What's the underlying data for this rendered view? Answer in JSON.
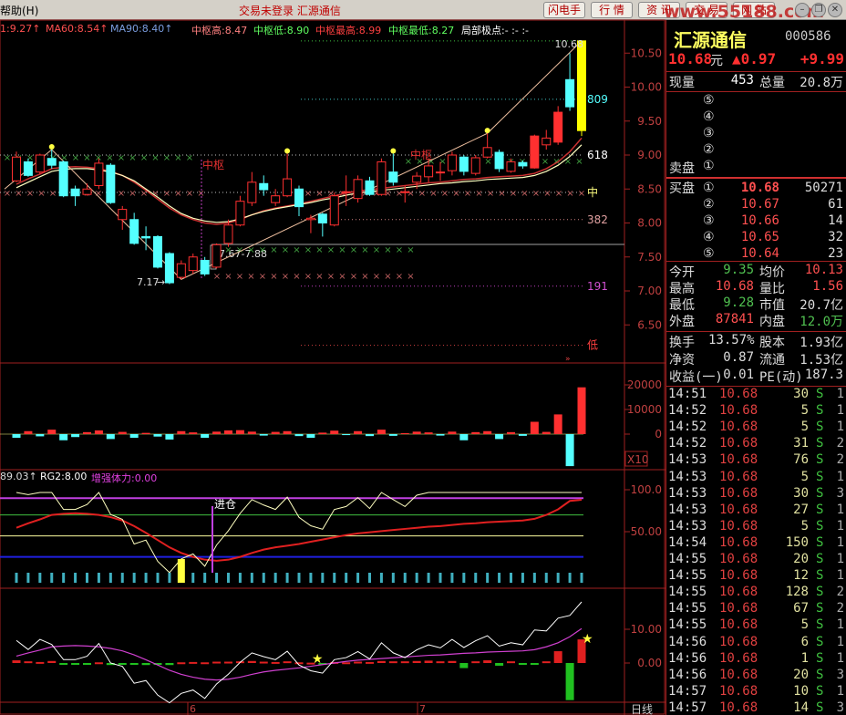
{
  "menu": {
    "help": "帮助(H)"
  },
  "window_title": "交易未登录  汇源通信",
  "toolbar": {
    "buttons": [
      "闪电手",
      "行 情",
      "资 讯",
      "交 易",
      "网 站"
    ],
    "watermark": "www.55188.com",
    "controls": [
      "–",
      "❐",
      "✕"
    ]
  },
  "indicators": {
    "ma_partial": "1:9.27↑",
    "ma60": "MA60:8.54↑",
    "ma90": "MA90:8.40↑",
    "zs_high": "中枢高:8.47",
    "zs_low": "中枢低:8.90",
    "zs_max": "中枢最高:8.99",
    "zs_min": "中枢最低:8.27",
    "local_extreme": "局部极点:- :- :-"
  },
  "annotations": {
    "high_price": "10.68",
    "low_price": "7.17",
    "range": "7.67-7.88",
    "zhongshu1": "中枢",
    "zhongshu2": "中枢",
    "fib809": "809",
    "fib618": "618",
    "mid": "中",
    "fib382": "382",
    "fib191": "191",
    "low": "低",
    "jincang": "进仓"
  },
  "price_axis": [
    "10.50",
    "10.00",
    "9.50",
    "9.00",
    "8.50",
    "8.00",
    "7.50",
    "7.00",
    "6.50"
  ],
  "volume_axis": [
    "20000",
    "10000",
    "0"
  ],
  "volume_unit": "X10",
  "rsi_header": {
    "v1": "89.03↑",
    "rg2": "RG2:8.00",
    "strength": "增强体力:0.00"
  },
  "rsi_axis": [
    "100.0",
    "50.00"
  ],
  "macd_axis": [
    "10.00",
    "0.00"
  ],
  "date_axis": {
    "m6": "6",
    "m7": "7",
    "period": "日线"
  },
  "colors": {
    "up": "#ff3030",
    "down": "#54ffff",
    "limit": "#ffff00",
    "ma60": "#c83030",
    "ma90": "#ffffc0",
    "accent": "#a02020"
  },
  "chart_data": {
    "type": "candlestick",
    "candles": [
      [
        8.62,
        8.97,
        9.05,
        8.6
      ],
      [
        8.9,
        8.7,
        8.95,
        8.68
      ],
      [
        8.75,
        9.0,
        9.02,
        8.72
      ],
      [
        8.95,
        8.85,
        9.08,
        8.8
      ],
      [
        8.9,
        8.4,
        8.92,
        8.38
      ],
      [
        8.5,
        8.4,
        8.55,
        8.25
      ],
      [
        8.42,
        8.5,
        8.58,
        8.4
      ],
      [
        8.55,
        8.88,
        8.95,
        8.5
      ],
      [
        8.85,
        8.3,
        8.88,
        8.28
      ],
      [
        8.05,
        8.2,
        8.25,
        7.9
      ],
      [
        8.05,
        7.7,
        8.15,
        7.68
      ],
      [
        7.8,
        7.78,
        7.95,
        7.6
      ],
      [
        7.8,
        7.35,
        7.82,
        7.33
      ],
      [
        7.55,
        7.12,
        7.57,
        7.1
      ],
      [
        7.2,
        7.4,
        7.45,
        7.17
      ],
      [
        7.3,
        7.5,
        7.55,
        7.25
      ],
      [
        7.45,
        7.25,
        7.5,
        7.22
      ],
      [
        7.35,
        7.68,
        7.7,
        7.33
      ],
      [
        7.7,
        7.97,
        8.05,
        7.65
      ],
      [
        7.97,
        8.32,
        8.4,
        7.95
      ],
      [
        8.3,
        8.6,
        8.75,
        8.25
      ],
      [
        8.58,
        8.49,
        8.7,
        8.4
      ],
      [
        8.3,
        8.4,
        8.5,
        8.25
      ],
      [
        8.4,
        8.65,
        9.02,
        8.38
      ],
      [
        8.5,
        8.24,
        8.55,
        8.1
      ],
      [
        8.05,
        8.07,
        8.12,
        7.85
      ],
      [
        8.13,
        8.0,
        8.15,
        7.8
      ],
      [
        7.97,
        8.4,
        8.45,
        7.95
      ],
      [
        8.45,
        8.46,
        8.7,
        8.25
      ],
      [
        8.36,
        8.64,
        8.7,
        8.3
      ],
      [
        8.62,
        8.42,
        8.68,
        8.4
      ],
      [
        8.42,
        8.9,
        8.95,
        8.4
      ],
      [
        8.75,
        8.6,
        9.02,
        8.55
      ],
      [
        8.45,
        8.46,
        8.55,
        8.3
      ],
      [
        8.6,
        8.69,
        8.75,
        8.5
      ],
      [
        8.68,
        8.84,
        8.95,
        8.6
      ],
      [
        8.75,
        8.75,
        8.9,
        8.62
      ],
      [
        8.77,
        9.0,
        9.05,
        8.7
      ],
      [
        8.97,
        8.76,
        9.0,
        8.7
      ],
      [
        8.73,
        8.96,
        9.0,
        8.7
      ],
      [
        8.97,
        9.11,
        9.32,
        8.95
      ],
      [
        9.04,
        8.8,
        9.08,
        8.75
      ],
      [
        8.76,
        8.9,
        8.95,
        8.74
      ],
      [
        8.89,
        8.84,
        8.92,
        8.8
      ],
      [
        8.81,
        9.28,
        9.3,
        8.8
      ],
      [
        9.15,
        9.25,
        9.37,
        9.08
      ],
      [
        9.19,
        9.63,
        9.72,
        9.15
      ],
      [
        10.11,
        9.71,
        10.5,
        9.65
      ],
      [
        9.36,
        10.68,
        10.68,
        9.28
      ]
    ],
    "solid_up": [
      44,
      46
    ],
    "limit_up": [
      48
    ],
    "ma60": [
      8.57,
      8.65,
      8.72,
      8.8,
      8.82,
      8.83,
      8.82,
      8.8,
      8.76,
      8.7,
      8.6,
      8.48,
      8.35,
      8.22,
      8.12,
      8.05,
      8.0,
      7.98,
      8.0,
      8.05,
      8.12,
      8.18,
      8.22,
      8.25,
      8.28,
      8.32,
      8.36,
      8.4,
      8.44,
      8.47,
      8.49,
      8.51,
      8.53,
      8.55,
      8.57,
      8.59,
      8.6,
      8.62,
      8.64,
      8.65,
      8.67,
      8.68,
      8.69,
      8.7,
      8.73,
      8.8,
      8.9,
      9.05,
      9.25
    ],
    "ma90": [
      8.52,
      8.6,
      8.68,
      8.76,
      8.79,
      8.8,
      8.8,
      8.78,
      8.75,
      8.7,
      8.62,
      8.5,
      8.38,
      8.25,
      8.14,
      8.07,
      8.03,
      8.01,
      8.02,
      8.06,
      8.12,
      8.17,
      8.21,
      8.24,
      8.27,
      8.3,
      8.34,
      8.37,
      8.41,
      8.44,
      8.46,
      8.48,
      8.5,
      8.52,
      8.54,
      8.56,
      8.58,
      8.59,
      8.61,
      8.62,
      8.64,
      8.65,
      8.66,
      8.67,
      8.7,
      8.76,
      8.85,
      8.98,
      9.15
    ],
    "zigzag": [
      [
        0,
        8.5
      ],
      [
        3,
        9.08
      ],
      [
        14,
        7.17
      ],
      [
        40,
        9.32
      ],
      [
        48,
        10.68
      ]
    ],
    "levels": {
      "809": 9.82,
      "618": 9.0,
      "mid": 8.45,
      "382": 8.05,
      "191": 7.07,
      "low": 6.2,
      "top": 10.68
    },
    "volume": [
      -1500,
      1200,
      -900,
      1800,
      -2500,
      -1200,
      800,
      1500,
      -2000,
      900,
      -1500,
      500,
      -1000,
      -2200,
      1200,
      700,
      -1500,
      1000,
      1500,
      1600,
      1000,
      -600,
      900,
      1200,
      -800,
      -1500,
      600,
      1400,
      -400,
      1200,
      -800,
      1800,
      -700,
      400,
      1000,
      700,
      -600,
      1000,
      -2500,
      800,
      1200,
      -2000,
      800,
      -700,
      5000,
      900,
      8000,
      -13000,
      19000
    ],
    "rsi_levels": [
      90,
      70,
      45,
      20
    ],
    "macd_hist": [
      0.8,
      0.5,
      0.3,
      0.6,
      -0.3,
      -0.5,
      -0.4,
      0.2,
      -0.6,
      -0.2,
      -0.5,
      -0.6,
      -0.5,
      -0.6,
      0.2,
      0.3,
      0.2,
      0.4,
      0.4,
      0.5,
      0.6,
      0.4,
      0.3,
      0.5,
      0.2,
      0.1,
      -0.2,
      0.3,
      0.2,
      0.4,
      0.3,
      0.6,
      0.5,
      0.5,
      0.6,
      0.7,
      0.5,
      0.6,
      -1.5,
      0.5,
      0.8,
      -0.8,
      0.5,
      -0.3,
      -0.5,
      0.5,
      3.5,
      -11,
      7
    ]
  },
  "quote": {
    "name": "汇源通信",
    "code": "000586",
    "price": "10.68",
    "unit": "元",
    "change": "▲0.97",
    "pct": "+9.99",
    "now_vol_label": "现量",
    "now_vol": "453",
    "total_vol_label": "总量",
    "total_vol": "20.8万",
    "sell_label": "卖盘",
    "buy_label": "买盘",
    "levels_sell": [
      "⑤",
      "④",
      "③",
      "②",
      "①"
    ],
    "buy": [
      {
        "n": "①",
        "p": "10.68",
        "v": "50271"
      },
      {
        "n": "②",
        "p": "10.67",
        "v": "61"
      },
      {
        "n": "③",
        "p": "10.66",
        "v": "14"
      },
      {
        "n": "④",
        "p": "10.65",
        "v": "32"
      },
      {
        "n": "⑤",
        "p": "10.64",
        "v": "23"
      }
    ],
    "stats": [
      [
        "今开",
        "9.35",
        "均价",
        "10.13"
      ],
      [
        "最高",
        "10.68",
        "量比",
        "1.56"
      ],
      [
        "最低",
        "9.28",
        "市值",
        "20.7亿"
      ],
      [
        "外盘",
        "87841",
        "内盘",
        "12.0万"
      ]
    ],
    "stats2": [
      [
        "换手",
        "13.57%",
        "股本",
        "1.93亿"
      ],
      [
        "净资",
        "0.87",
        "流通",
        "1.53亿"
      ],
      [
        "收益(一)",
        "0.01",
        "PE(动)",
        "187.3"
      ]
    ],
    "trades": [
      [
        "14:51",
        "10.68",
        "30",
        "S",
        "1"
      ],
      [
        "14:52",
        "10.68",
        "5",
        "S",
        "1"
      ],
      [
        "14:52",
        "10.68",
        "5",
        "S",
        "1"
      ],
      [
        "14:52",
        "10.68",
        "31",
        "S",
        "2"
      ],
      [
        "14:53",
        "10.68",
        "76",
        "S",
        "2"
      ],
      [
        "14:53",
        "10.68",
        "5",
        "S",
        "1"
      ],
      [
        "14:53",
        "10.68",
        "30",
        "S",
        "3"
      ],
      [
        "14:53",
        "10.68",
        "27",
        "S",
        "1"
      ],
      [
        "14:53",
        "10.68",
        "5",
        "S",
        "1"
      ],
      [
        "14:54",
        "10.68",
        "150",
        "S",
        "1"
      ],
      [
        "14:55",
        "10.68",
        "20",
        "S",
        "1"
      ],
      [
        "14:55",
        "10.68",
        "12",
        "S",
        "1"
      ],
      [
        "14:55",
        "10.68",
        "128",
        "S",
        "2"
      ],
      [
        "14:55",
        "10.68",
        "67",
        "S",
        "2"
      ],
      [
        "14:55",
        "10.68",
        "5",
        "S",
        "1"
      ],
      [
        "14:56",
        "10.68",
        "6",
        "S",
        "1"
      ],
      [
        "14:56",
        "10.68",
        "1",
        "S",
        "1"
      ],
      [
        "14:56",
        "10.68",
        "20",
        "S",
        "3"
      ],
      [
        "14:57",
        "10.68",
        "10",
        "S",
        "1"
      ],
      [
        "14:57",
        "10.68",
        "14",
        "S",
        "3"
      ]
    ]
  }
}
